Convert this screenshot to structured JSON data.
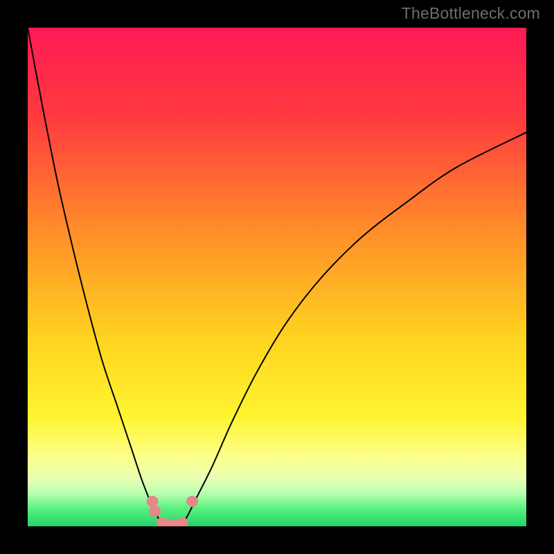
{
  "watermark": "TheBottleneck.com",
  "chart_data": {
    "type": "line",
    "title": "",
    "xlabel": "",
    "ylabel": "",
    "xlim": [
      0,
      100
    ],
    "ylim": [
      0,
      100
    ],
    "grid": false,
    "legend": false,
    "series": [
      {
        "name": "bottleneck-curve",
        "x": [
          0,
          3,
          6,
          9,
          12,
          15,
          18,
          21,
          23,
          25,
          26,
          27,
          28,
          29,
          30,
          31,
          32,
          34,
          37,
          41,
          46,
          52,
          59,
          67,
          76,
          86,
          100
        ],
        "y": [
          100,
          84,
          69,
          56,
          44,
          33,
          24,
          15,
          9,
          4,
          2,
          0.5,
          0,
          0,
          0,
          0.5,
          2,
          6,
          12,
          21,
          31,
          41,
          50,
          58,
          65,
          72,
          79
        ]
      }
    ],
    "markers": [
      {
        "name": "marker-left-upper",
        "x": 25.0,
        "y": 5.0
      },
      {
        "name": "marker-left-lower",
        "x": 25.5,
        "y": 3.0
      },
      {
        "name": "marker-bottom-1",
        "x": 27.0,
        "y": 0.7
      },
      {
        "name": "marker-bottom-2",
        "x": 28.3,
        "y": 0.3
      },
      {
        "name": "marker-bottom-3",
        "x": 29.7,
        "y": 0.3
      },
      {
        "name": "marker-bottom-4",
        "x": 31.0,
        "y": 0.7
      },
      {
        "name": "marker-right",
        "x": 33.0,
        "y": 5.0
      }
    ],
    "background": {
      "type": "vertical-gradient",
      "stops": [
        {
          "pos": 0.0,
          "color": "#ff1a55"
        },
        {
          "pos": 0.18,
          "color": "#ff3a3f"
        },
        {
          "pos": 0.4,
          "color": "#ff8b2a"
        },
        {
          "pos": 0.62,
          "color": "#ffd21f"
        },
        {
          "pos": 0.78,
          "color": "#fff430"
        },
        {
          "pos": 0.86,
          "color": "#fcff8a"
        },
        {
          "pos": 0.905,
          "color": "#e7ffb3"
        },
        {
          "pos": 0.935,
          "color": "#b7ffb0"
        },
        {
          "pos": 0.965,
          "color": "#58f07e"
        },
        {
          "pos": 1.0,
          "color": "#21d36a"
        }
      ]
    },
    "curve_color": "#000000",
    "marker_color": "#e68787"
  }
}
